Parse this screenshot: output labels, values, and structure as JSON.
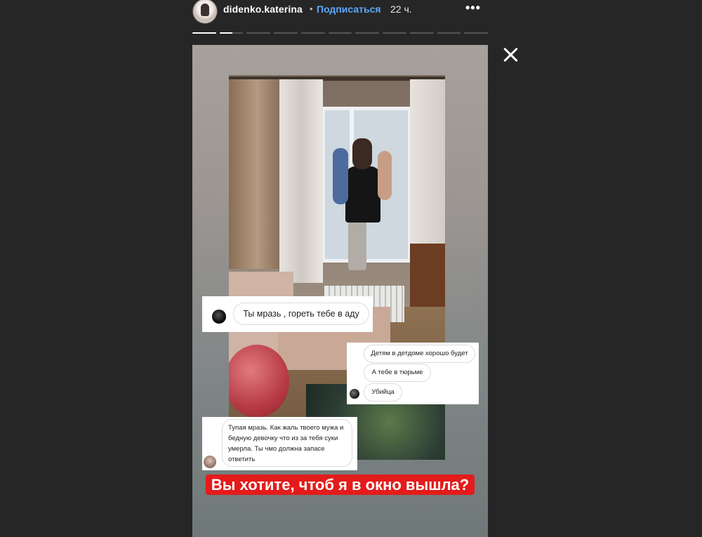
{
  "header": {
    "username": "didenko.katerina",
    "separator": "•",
    "subscribe_label": "Подписаться",
    "time": "22 ч.",
    "more_label": "•••"
  },
  "progress": {
    "segments_total": 11,
    "segments_done": 1,
    "current_segment_fraction": 0.55
  },
  "story": {
    "comments": [
      {
        "text": "Ты мразь , гореть тебе в аду"
      },
      {
        "lines": [
          "Детям в детдоме хорошо будет",
          "А тебе в тюрьме",
          "Убийца"
        ]
      },
      {
        "text": "Тупая мразь. Как жаль твоего мужа и бедную девочку что из за тебя суки умерла. Ты чмо должна запасе ответить"
      }
    ],
    "caption": "Вы хотите, чтоб я в окно вышла?"
  },
  "colors": {
    "background": "#262626",
    "link": "#5aa9ff",
    "caption_bg": "#e41b1b"
  },
  "icons": {
    "close": "close-icon",
    "more": "more-icon"
  }
}
